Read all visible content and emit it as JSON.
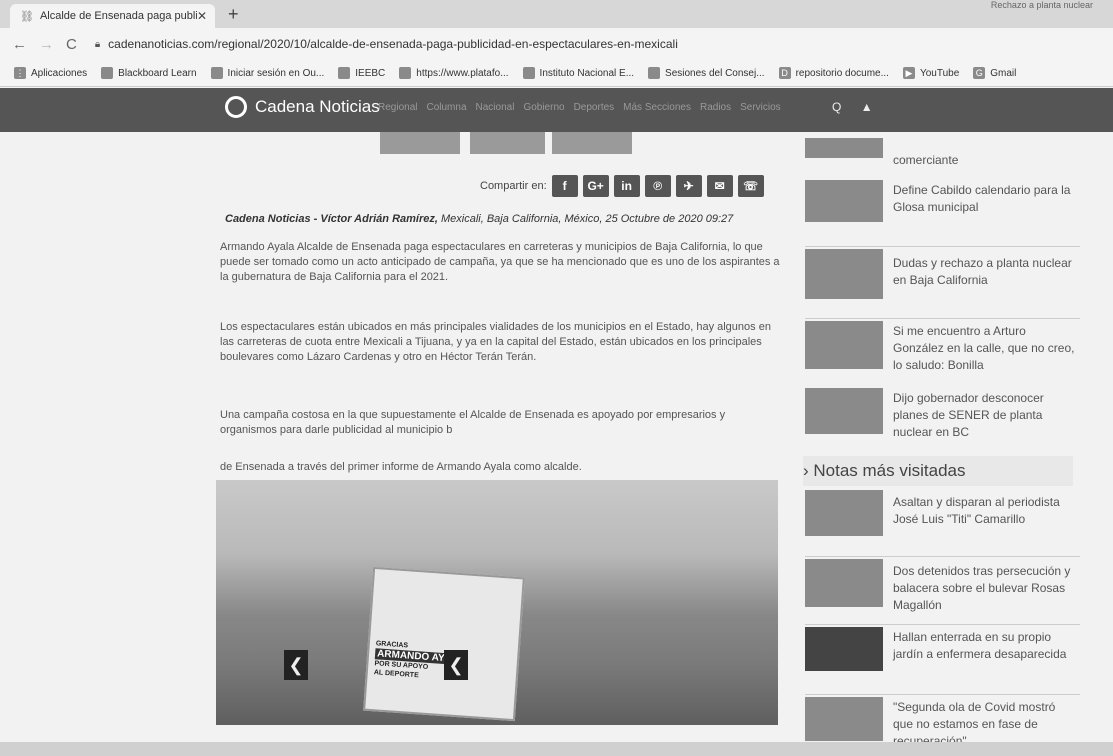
{
  "browser": {
    "tab_title": "Alcalde de Ensenada paga public",
    "url": "cadenanoticias.com/regional/2020/10/alcalde-de-ensenada-paga-publicidad-en-espectaculares-en-mexicali",
    "topright_text": "Rechazo a planta nuclear",
    "bookmarks": [
      {
        "label": "Aplicaciones"
      },
      {
        "label": "Blackboard Learn"
      },
      {
        "label": "Iniciar sesión en Ou..."
      },
      {
        "label": "IEEBC"
      },
      {
        "label": "https://www.platafo..."
      },
      {
        "label": "Instituto Nacional E..."
      },
      {
        "label": "Sesiones del Consej..."
      },
      {
        "label": "repositorio docume..."
      },
      {
        "label": "YouTube"
      },
      {
        "label": "Gmail"
      }
    ]
  },
  "site": {
    "name": "Cadena Noticias",
    "menu": [
      "Regional",
      "Columna",
      "Nacional",
      "Gobierno",
      "Deportes",
      "Más Secciones",
      "Radios",
      "Servicios"
    ]
  },
  "article": {
    "share_label": "Compartir en:",
    "byline_author": "Cadena Noticias - Víctor Adrián Ramírez,",
    "byline_location": "Mexicali, Baja California, México,",
    "byline_date": "25 Octubre de 2020 09:27",
    "paragraphs": [
      "Armando Ayala Alcalde de Ensenada paga espectaculares en carreteras y municipios de Baja California, lo que puede ser tomado como un acto anticipado de campaña, ya que se ha mencionado que es uno de los aspirantes a la gubernatura de Baja California para el 2021.",
      "Los espectaculares están ubicados en más principales vialidades de los municipios en el Estado, hay algunos en las carreteras de cuota entre Mexicali a Tijuana, y ya en la capital del Estado, están ubicados en los principales boulevares como Lázaro Cardenas y otro en Héctor Terán Terán.",
      "Una campaña costosa en la que supuestamente el Alcalde de Ensenada es apoyado por empresarios y organismos para darle publicidad al municipio b",
      "de Ensenada a través del primer informe de Armando Ayala como alcalde."
    ],
    "billboard_lines": [
      "GRACIAS",
      "ARMANDO AYALA",
      "POR SU APOYO",
      "AL DEPORTE"
    ]
  },
  "sidebar": {
    "top_items": [
      {
        "title": "comerciante"
      },
      {
        "title": "Define Cabildo calendario para la Glosa municipal"
      },
      {
        "title": "Dudas y rechazo a planta nuclear en Baja California"
      },
      {
        "title": "Si me encuentro a Arturo González en la calle, que no creo, lo saludo: Bonilla"
      },
      {
        "title": "Dijo gobernador desconocer planes de SENER de planta nuclear en BC"
      }
    ],
    "section_title": "› Notas más visitadas",
    "visited_items": [
      {
        "title": "Asaltan y disparan al periodista José Luis \"Titi\" Camarillo"
      },
      {
        "title": "Dos detenidos tras persecución y balacera sobre el bulevar Rosas Magallón"
      },
      {
        "title": "Hallan enterrada en su propio jardín a enfermera desaparecida"
      },
      {
        "title": "\"Segunda ola de Covid mostró que no estamos en fase de recuperación\""
      }
    ]
  }
}
